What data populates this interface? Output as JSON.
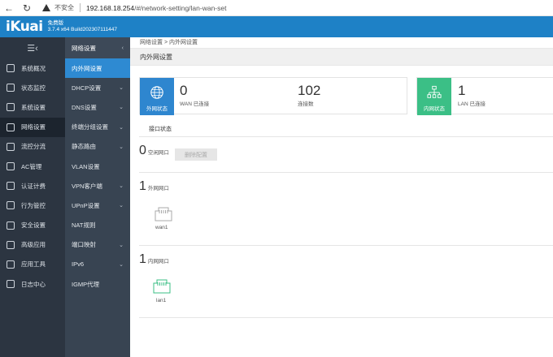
{
  "browser": {
    "insecure_label": "不安全",
    "url_host": "192.168.18.254",
    "url_path": "/#/network-setting/lan-wan-set"
  },
  "brand": {
    "logo": "iKuai",
    "edition": "免费版",
    "version": "3.7.4 x64 Build202307111447"
  },
  "sidebar": {
    "items": [
      {
        "label": "系统概况",
        "icon": "gauge-icon"
      },
      {
        "label": "状态监控",
        "icon": "pulse-icon"
      },
      {
        "label": "系统设置",
        "icon": "gear-icon"
      },
      {
        "label": "网络设置",
        "icon": "network-icon",
        "active": true
      },
      {
        "label": "流控分流",
        "icon": "flow-icon"
      },
      {
        "label": "AC管理",
        "icon": "ac-icon"
      },
      {
        "label": "认证计费",
        "icon": "id-card-icon"
      },
      {
        "label": "行为管控",
        "icon": "swap-icon"
      },
      {
        "label": "安全设置",
        "icon": "firewall-icon"
      },
      {
        "label": "高级应用",
        "icon": "check-box-icon"
      },
      {
        "label": "应用工具",
        "icon": "tools-icon"
      },
      {
        "label": "日志中心",
        "icon": "log-icon"
      }
    ]
  },
  "submenu": {
    "title": "网络设置",
    "items": [
      {
        "label": "内外网设置",
        "active": true,
        "arrow": false
      },
      {
        "label": "DHCP设置",
        "arrow": true
      },
      {
        "label": "DNS设置",
        "arrow": true
      },
      {
        "label": "终端分组设置",
        "arrow": true
      },
      {
        "label": "静态路由",
        "arrow": true
      },
      {
        "label": "VLAN设置",
        "arrow": false
      },
      {
        "label": "VPN客户端",
        "arrow": true
      },
      {
        "label": "UPnP设置",
        "arrow": true
      },
      {
        "label": "NAT规则",
        "arrow": false
      },
      {
        "label": "端口映射",
        "arrow": true
      },
      {
        "label": "IPv6",
        "arrow": true
      },
      {
        "label": "IGMP代理",
        "arrow": false
      }
    ]
  },
  "breadcrumb": "网络设置 > 内外网设置",
  "page_title": "内外网设置",
  "wan_card": {
    "badge": "外网状态",
    "connected_count": "0",
    "connected_label": "WAN 已连接",
    "connections_count": "102",
    "connections_label": "连接数",
    "color": "#2e86cf"
  },
  "lan_card": {
    "badge": "内网状态",
    "connected_count": "1",
    "connected_label": "LAN 已连接",
    "color": "#3bbf86"
  },
  "interface_status_title": "接口状态",
  "idle": {
    "count": "0",
    "label": "空闲网口",
    "delete_button": "删除配置"
  },
  "wan_ports": {
    "count": "1",
    "label": "外网网口",
    "ports": [
      {
        "name": "wan1"
      }
    ]
  },
  "lan_ports": {
    "count": "1",
    "label": "内网网口",
    "ports": [
      {
        "name": "lan1"
      }
    ]
  }
}
